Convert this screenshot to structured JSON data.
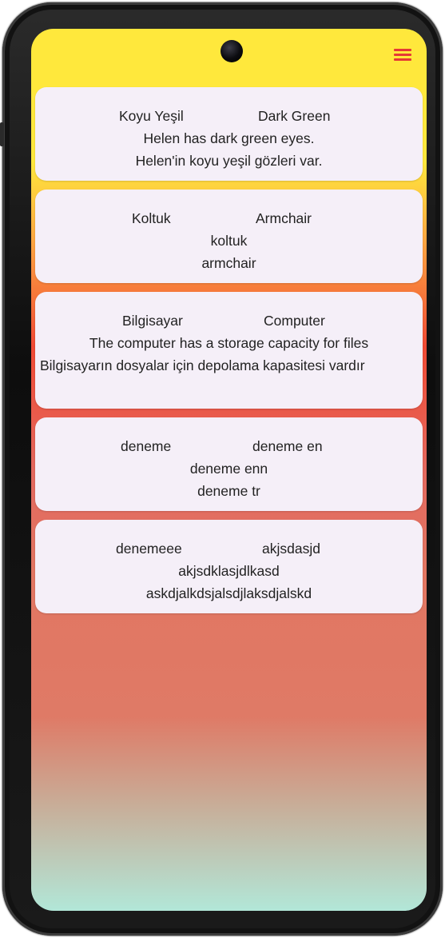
{
  "cards": [
    {
      "tr": "Koyu Yeşil",
      "en": "Dark Green",
      "line1": "Helen has dark green eyes.",
      "line2": "Helen'in koyu yeşil gözleri var."
    },
    {
      "tr": "Koltuk",
      "en": "Armchair",
      "line1": "koltuk",
      "line2": "armchair"
    },
    {
      "tr": "Bilgisayar",
      "en": "Computer",
      "line1": "The computer has a storage capacity for files",
      "line2": "Bilgisayarın dosyalar için depolama kapasitesi vardır"
    },
    {
      "tr": "deneme",
      "en": "deneme en",
      "line1": "deneme enn",
      "line2": "deneme tr"
    },
    {
      "tr": "denemeee",
      "en": "akjsdasjd",
      "line1": "akjsdklasjdlkasd",
      "line2": "askdjalkdsjalsdjlaksdjalskd"
    }
  ],
  "menu_icon": "hamburger-menu-icon",
  "accent_color": "#e53935"
}
